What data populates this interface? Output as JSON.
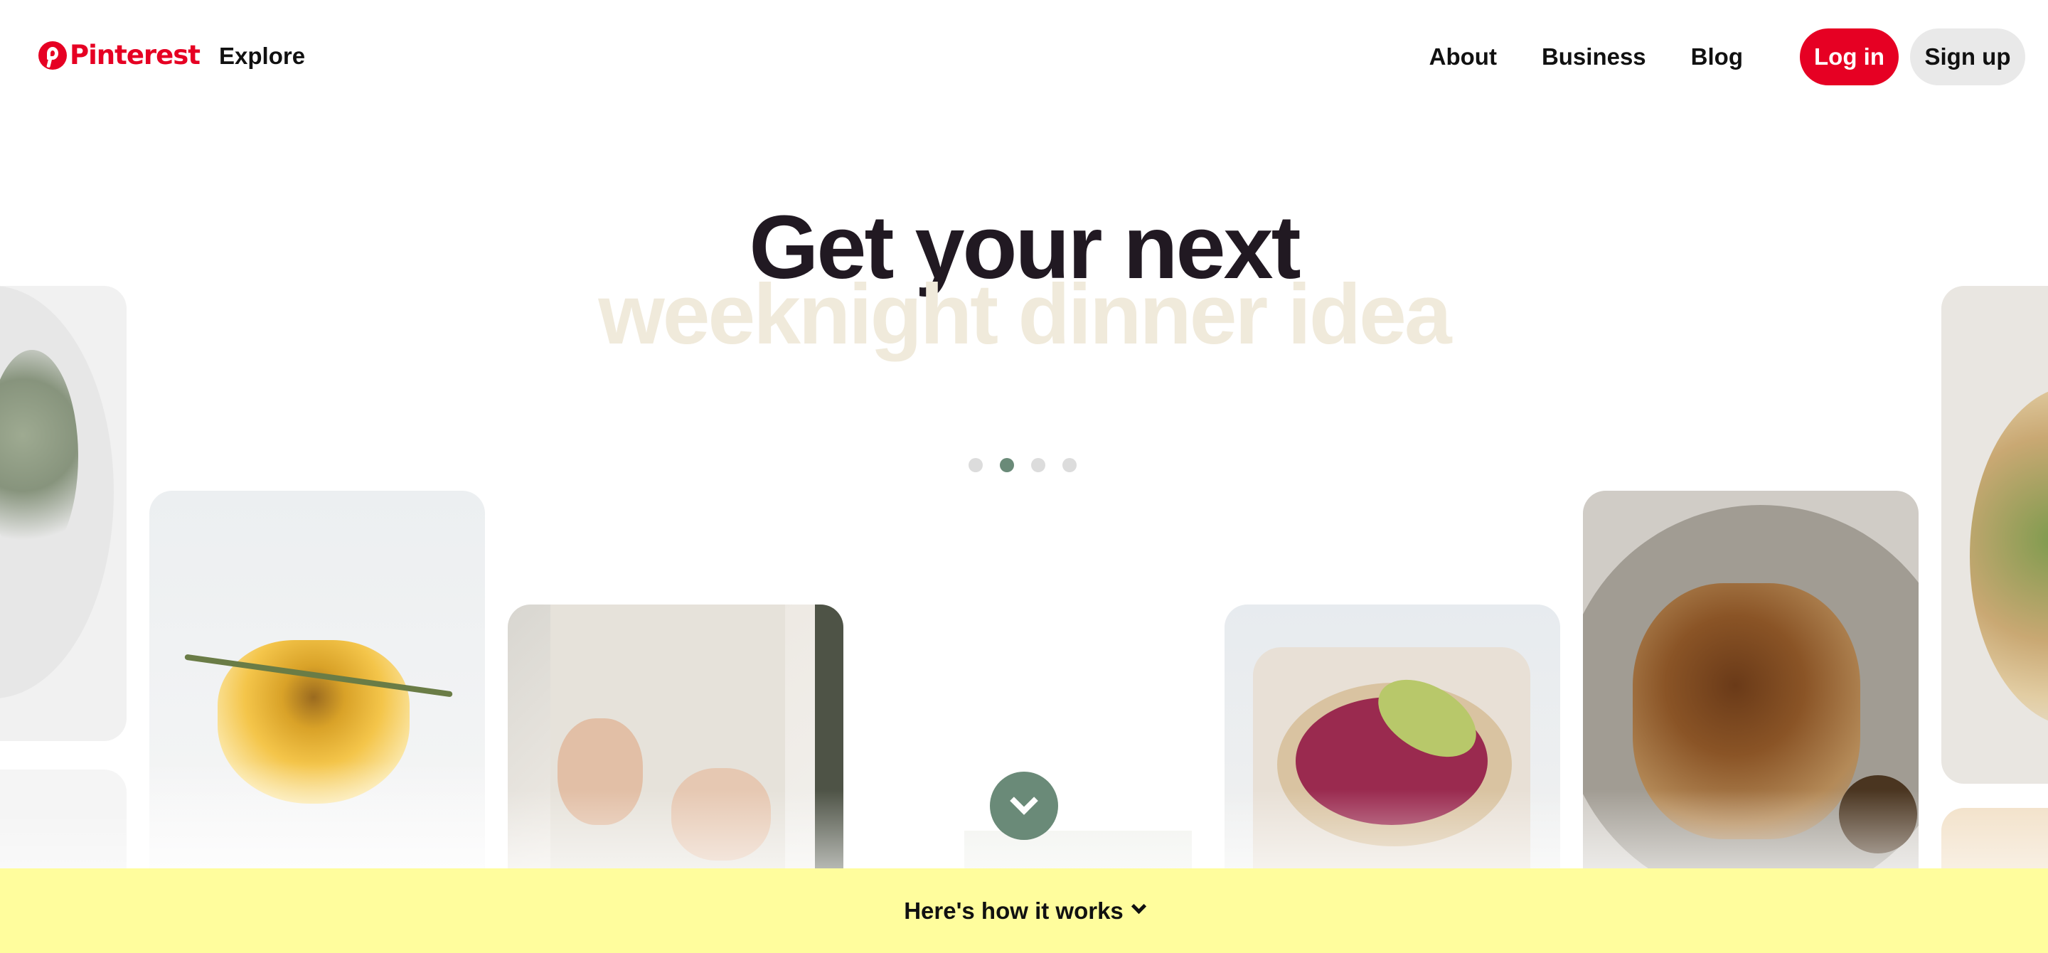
{
  "header": {
    "brand": "Pinterest",
    "explore_label": "Explore",
    "nav_links": [
      "About",
      "Business",
      "Blog"
    ],
    "login_label": "Log in",
    "signup_label": "Sign up",
    "brand_color": "#e60023"
  },
  "hero": {
    "title": "Get your next",
    "subtitle": "weeknight dinner idea",
    "carousel_total": 4,
    "carousel_active": 2
  },
  "images": [
    {
      "name": "salad-image"
    },
    {
      "name": "drink-image"
    },
    {
      "name": "cooking-hands-image"
    },
    {
      "name": "beet-toast-image"
    },
    {
      "name": "grilled-chicken-image"
    },
    {
      "name": "flatbread-image"
    }
  ],
  "banner": {
    "text": "Here's how it works"
  },
  "colors": {
    "accent_green": "#6a8a78",
    "banner_yellow": "#fffd9d",
    "subtitle_color": "#f0eadb"
  }
}
